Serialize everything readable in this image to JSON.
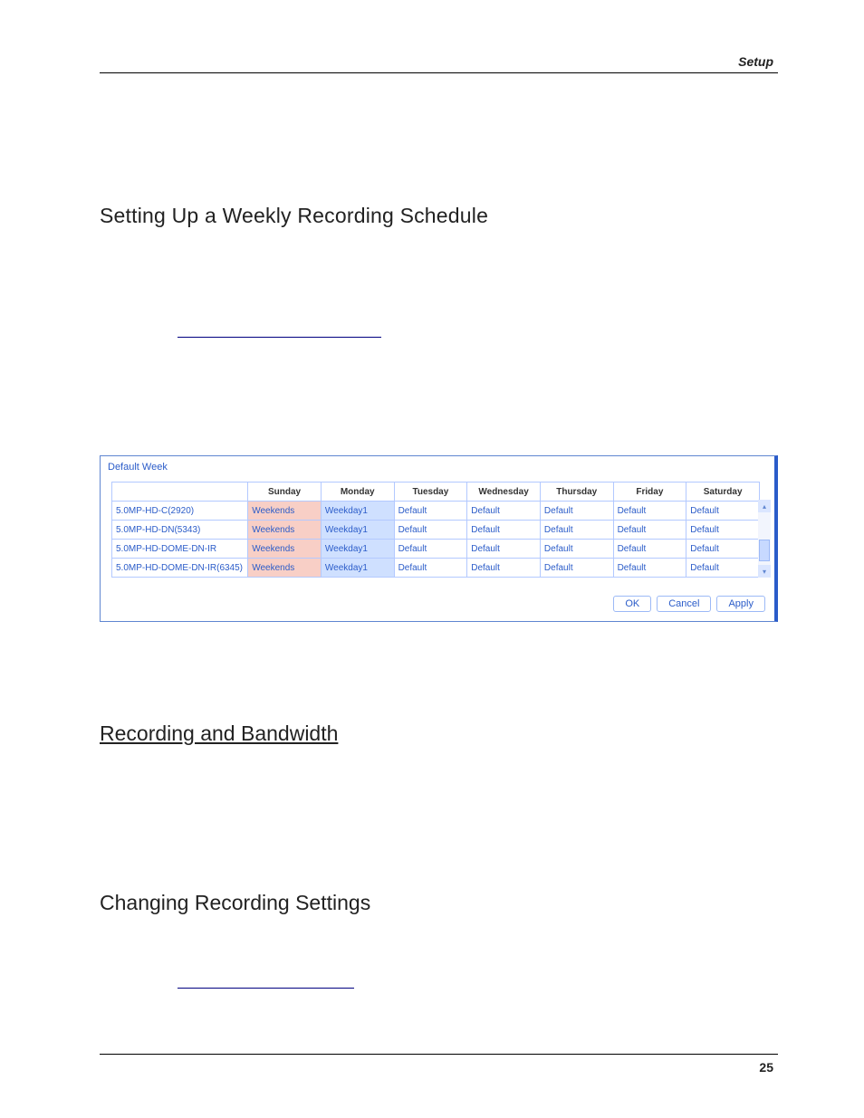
{
  "header": {
    "right_label": "Setup"
  },
  "footer": {
    "page_number": "25"
  },
  "section1": {
    "title": "Setting Up a Weekly Recording Schedule"
  },
  "panel": {
    "title": "Default Week",
    "columns": [
      "",
      "Sunday",
      "Monday",
      "Tuesday",
      "Wednesday",
      "Thursday",
      "Friday",
      "Saturday"
    ],
    "rows": [
      {
        "name": "5.0MP-HD-C(2920)",
        "cells": [
          "Weekends",
          "Weekday1",
          "Default",
          "Default",
          "Default",
          "Default",
          "Default"
        ]
      },
      {
        "name": "5.0MP-HD-DN(5343)",
        "cells": [
          "Weekends",
          "Weekday1",
          "Default",
          "Default",
          "Default",
          "Default",
          "Default"
        ]
      },
      {
        "name": "5.0MP-HD-DOME-DN-IR",
        "cells": [
          "Weekends",
          "Weekday1",
          "Default",
          "Default",
          "Default",
          "Default",
          "Default"
        ]
      },
      {
        "name": "5.0MP-HD-DOME-DN-IR(6345)",
        "cells": [
          "Weekends",
          "Weekday1",
          "Default",
          "Default",
          "Default",
          "Default",
          "Default"
        ]
      }
    ],
    "scroll_up_glyph": "▴",
    "scroll_dn_glyph": "▾",
    "buttons": {
      "ok": "OK",
      "cancel": "Cancel",
      "apply": "Apply"
    }
  },
  "section2": {
    "title": "Recording and Bandwidth"
  },
  "section3": {
    "title": "Changing Recording Settings"
  }
}
